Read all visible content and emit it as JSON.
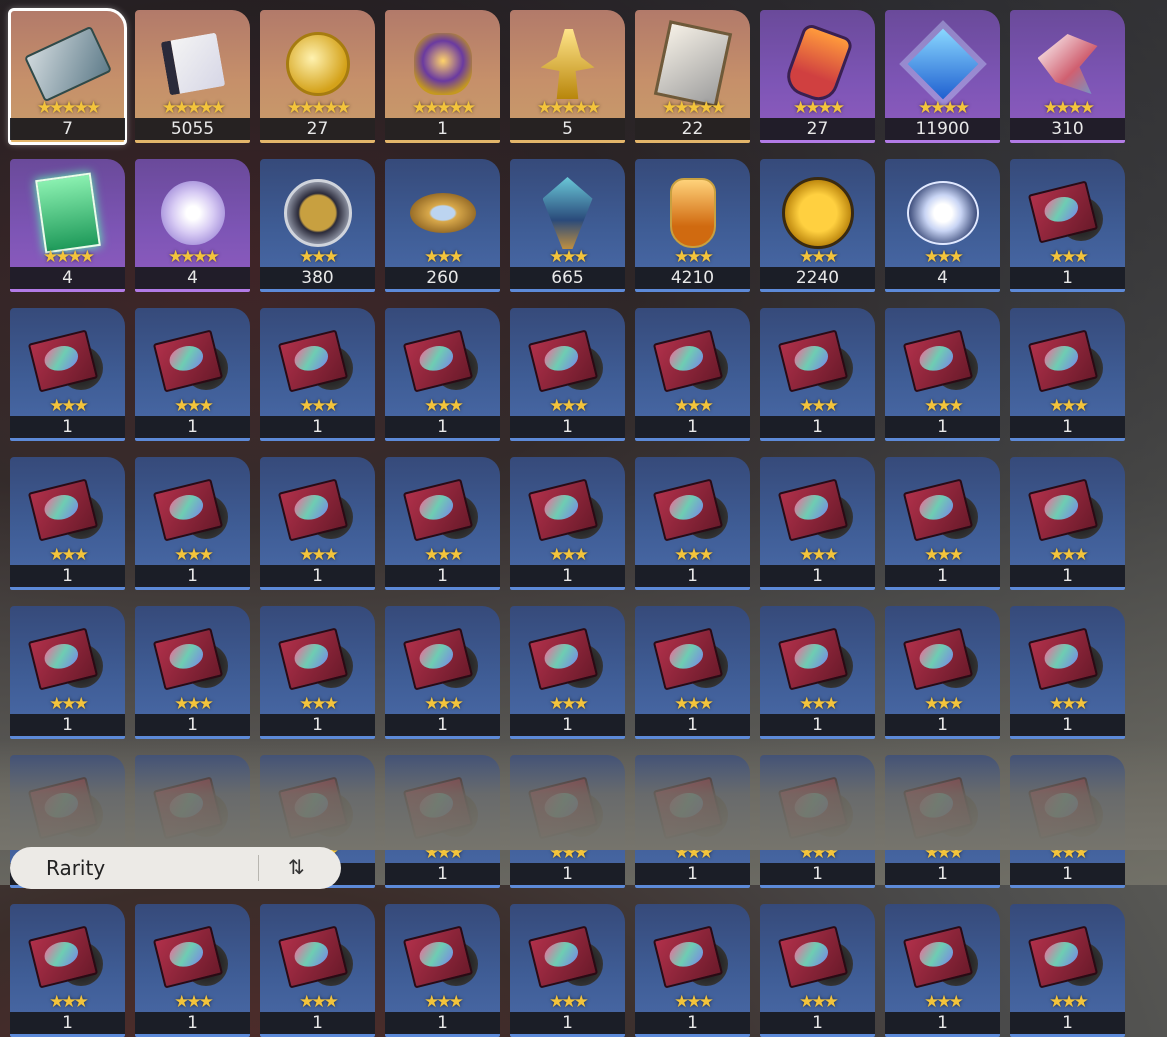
{
  "inventory": {
    "items": [
      {
        "count": "7",
        "stars": "★★★★★",
        "rarity": "r5",
        "icon": "ticket-icon",
        "selected": true
      },
      {
        "count": "5055",
        "stars": "★★★★★",
        "rarity": "r5",
        "icon": "book-icon"
      },
      {
        "count": "27",
        "stars": "★★★★★",
        "rarity": "r5",
        "icon": "gold-watch-icon"
      },
      {
        "count": "1",
        "stars": "★★★★★",
        "rarity": "r5",
        "icon": "gold-orb-icon"
      },
      {
        "count": "5",
        "stars": "★★★★★",
        "rarity": "r5",
        "icon": "gold-figure-icon"
      },
      {
        "count": "22",
        "stars": "★★★★★",
        "rarity": "r5",
        "icon": "silver-card-icon"
      },
      {
        "count": "27",
        "stars": "★★★★",
        "rarity": "r4",
        "icon": "potion-icon"
      },
      {
        "count": "11900",
        "stars": "★★★★",
        "rarity": "r4",
        "icon": "crystal-icon"
      },
      {
        "count": "310",
        "stars": "★★★★",
        "rarity": "r4",
        "icon": "shards-icon"
      },
      {
        "count": "4",
        "stars": "★★★★",
        "rarity": "r4",
        "icon": "green-ticket-icon"
      },
      {
        "count": "4",
        "stars": "★★★★",
        "rarity": "r4",
        "icon": "flower-icon"
      },
      {
        "count": "380",
        "stars": "★★★",
        "rarity": "r3",
        "icon": "medal-icon"
      },
      {
        "count": "260",
        "stars": "★★★",
        "rarity": "r3",
        "icon": "coins-icon"
      },
      {
        "count": "665",
        "stars": "★★★",
        "rarity": "r3",
        "icon": "leaf-icon"
      },
      {
        "count": "4210",
        "stars": "★★★",
        "rarity": "r3",
        "icon": "bottle-icon"
      },
      {
        "count": "2240",
        "stars": "★★★",
        "rarity": "r3",
        "icon": "gold-coin-icon"
      },
      {
        "count": "4",
        "stars": "★★★",
        "rarity": "r3",
        "icon": "badge-icon"
      },
      {
        "count": "1",
        "stars": "★★★",
        "rarity": "r3",
        "icon": "vinyl-record-icon"
      }
    ],
    "repeat_item": {
      "count": "1",
      "stars": "★★★",
      "rarity": "r3",
      "icon": "vinyl-record-icon"
    },
    "repeat_total": 36,
    "partial_total": 9
  },
  "sort": {
    "label": "Rarity",
    "toggle_symbol": "⇅"
  }
}
